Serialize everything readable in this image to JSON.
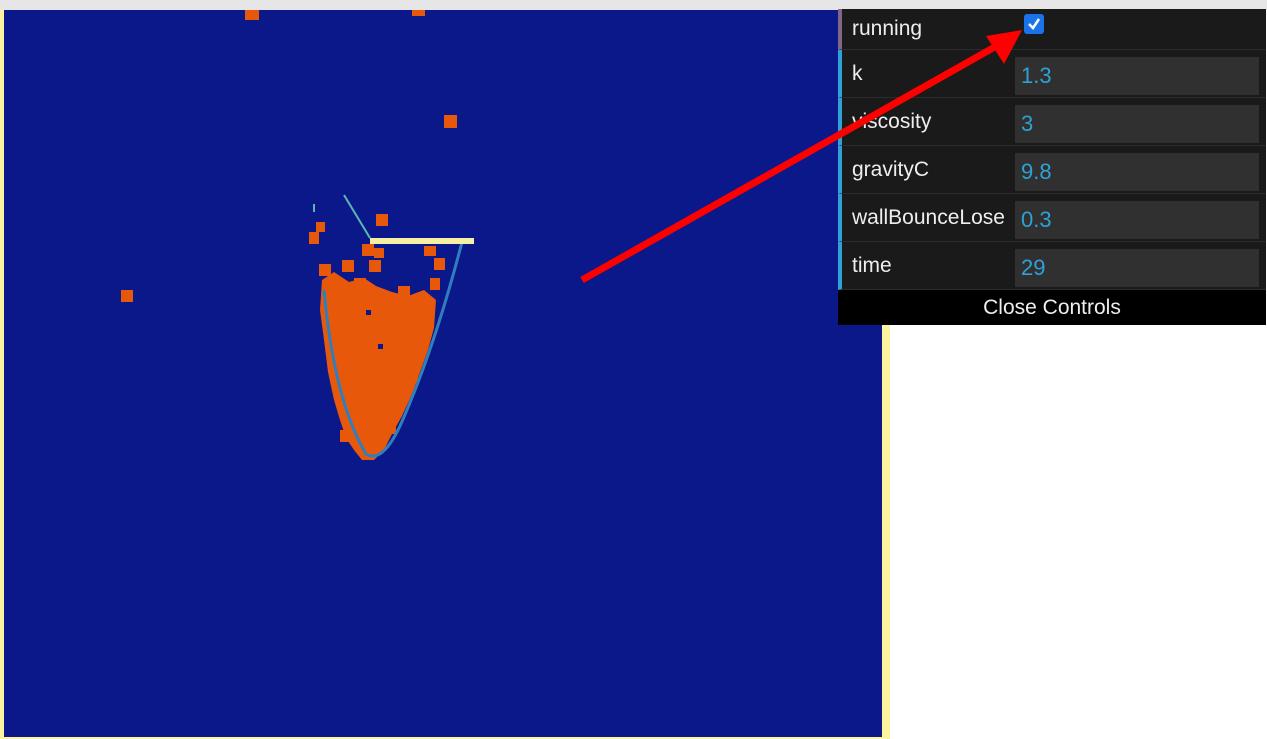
{
  "controls": {
    "running": {
      "label": "running",
      "checked": true
    },
    "k": {
      "label": "k",
      "value": "1.3"
    },
    "viscosity": {
      "label": "viscosity",
      "value": "3"
    },
    "gravityC": {
      "label": "gravityC",
      "value": "9.8"
    },
    "wallBounceLose": {
      "label": "wallBounceLose",
      "value": "0.3"
    },
    "time": {
      "label": "time",
      "value": "29"
    },
    "close_label": "Close Controls"
  },
  "colors": {
    "background": "#0a188a",
    "particles": "#e8580a",
    "container_curve": "#2f7fbf",
    "annotation_arrow": "#ff0000",
    "gui_accent": "#2fa1d6"
  }
}
